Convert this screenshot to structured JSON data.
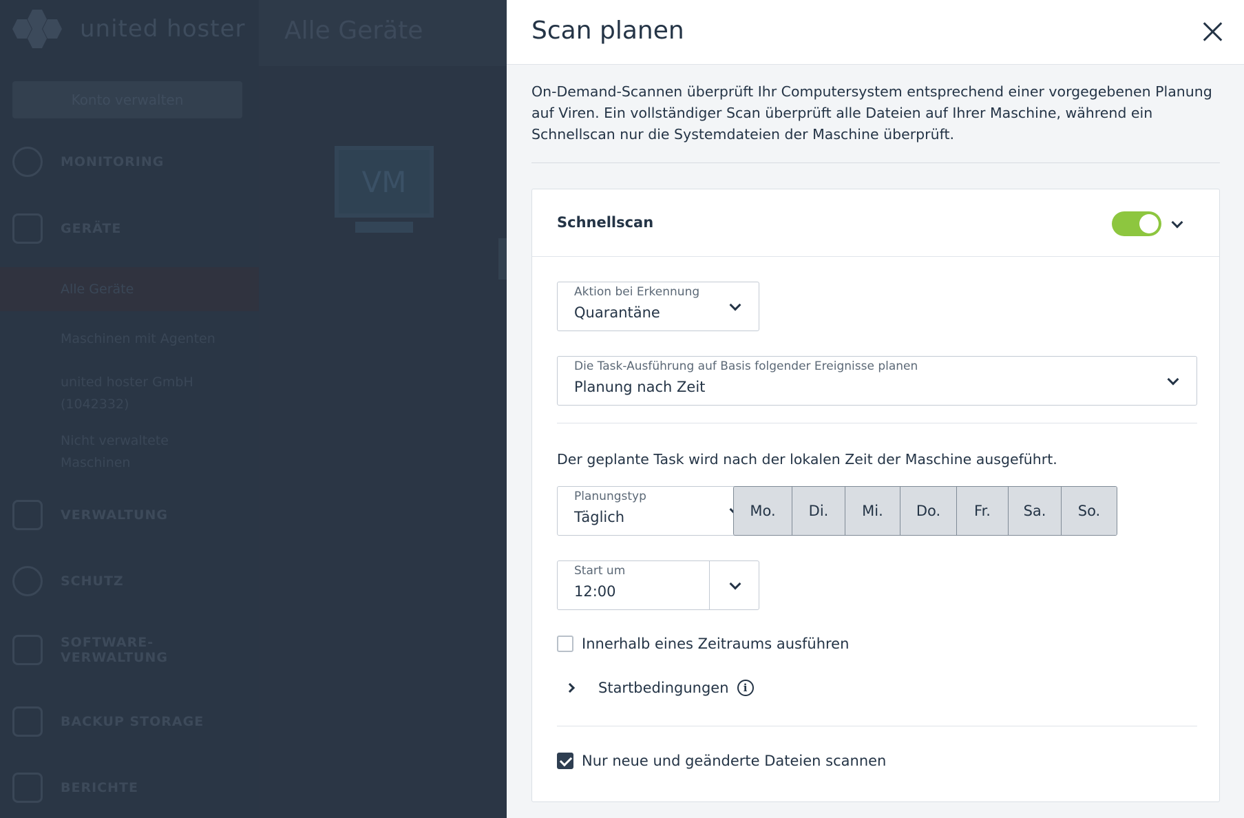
{
  "background": {
    "logo_text": "united hoster",
    "manage_account_label": "Konto verwalten",
    "nav": [
      {
        "label": "MONITORING",
        "icon": "gauge-icon"
      },
      {
        "label": "GERÄTE",
        "icon": "monitor-icon"
      },
      {
        "label": "VERWALTUNG",
        "icon": "copy-icon"
      },
      {
        "label": "SCHUTZ",
        "icon": "shield-icon"
      },
      {
        "label": "SOFTWARE-VERWALTUNG",
        "icon": "download-icon"
      },
      {
        "label": "BACKUP STORAGE",
        "icon": "hdd-icon"
      },
      {
        "label": "BERICHTE",
        "icon": "report-icon"
      }
    ],
    "sub_items": [
      "Alle Geräte",
      "Maschinen mit Agenten",
      "united hoster GmbH (1042332)",
      "Nicht verwaltete Maschinen"
    ],
    "page_title": "Alle Geräte",
    "vm_label": "VM"
  },
  "panel": {
    "title": "Scan planen",
    "description": "On-Demand-Scannen überprüft Ihr Computersystem entsprechend einer vorgegebenen Planung auf Viren. Ein vollständiger Scan überprüft alle Dateien auf Ihrer Maschine, während ein Schnellscan nur die Systemdateien der Maschine überprüft.",
    "card": {
      "title": "Schnellscan",
      "enabled": true,
      "action_field": {
        "label": "Aktion bei Erkennung",
        "value": "Quarantäne"
      },
      "schedule_field": {
        "label": "Die Task-Ausführung auf Basis folgender Ereignisse planen",
        "value": "Planung nach Zeit"
      },
      "info_text": "Der geplante Task wird nach der lokalen Zeit der Maschine ausgeführt.",
      "plan_type_field": {
        "label": "Planungstyp",
        "value": "Täglich"
      },
      "days": [
        "Mo.",
        "Di.",
        "Mi.",
        "Do.",
        "Fr.",
        "Sa.",
        "So."
      ],
      "start_field": {
        "label": "Start um",
        "value": "12:00"
      },
      "within_period": {
        "label": "Innerhalb eines Zeitraums ausführen",
        "checked": false
      },
      "start_conditions_label": "Startbedingungen",
      "only_new_files": {
        "label": "Nur neue und geänderte Dateien scannen",
        "checked": true
      }
    }
  },
  "colors": {
    "toggle_on": "#8dc63f",
    "text_primary": "#243446",
    "sidebar_bg": "#2a3645"
  }
}
